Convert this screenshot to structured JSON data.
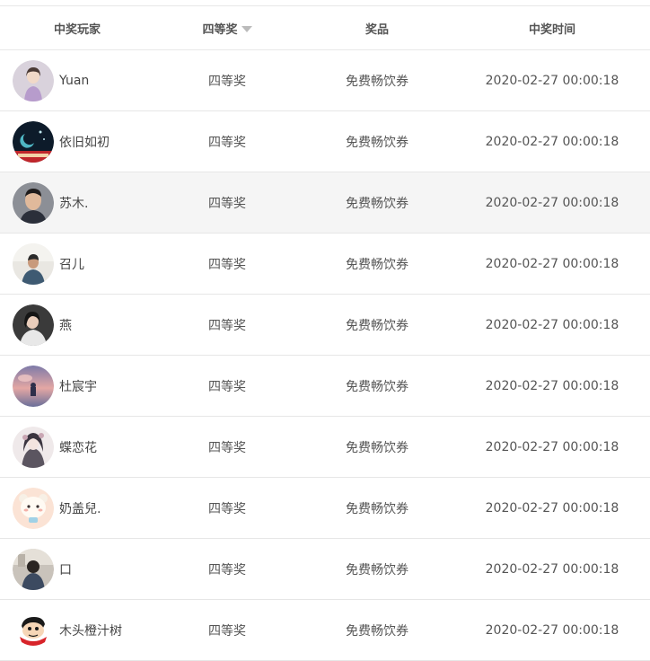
{
  "header": {
    "player": "中奖玩家",
    "tier": "四等奖",
    "prize": "奖品",
    "time": "中奖时间"
  },
  "rows": [
    {
      "name": "Yuan",
      "tier": "四等奖",
      "prize": "免费畅饮券",
      "time": "2020-02-27 00:00:18",
      "avatar": "avatar-girl-lavender"
    },
    {
      "name": "依旧如初",
      "tier": "四等奖",
      "prize": "免费畅饮券",
      "time": "2020-02-27 00:00:18",
      "avatar": "avatar-night-moon"
    },
    {
      "name": "苏木.",
      "tier": "四等奖",
      "prize": "免费畅饮券",
      "time": "2020-02-27 00:00:18",
      "avatar": "avatar-man-selfie"
    },
    {
      "name": "召儿",
      "tier": "四等奖",
      "prize": "免费畅饮券",
      "time": "2020-02-27 00:00:18",
      "avatar": "avatar-man-outdoor"
    },
    {
      "name": "燕",
      "tier": "四等奖",
      "prize": "免费畅饮券",
      "time": "2020-02-27 00:00:18",
      "avatar": "avatar-woman-dark"
    },
    {
      "name": "杜宸宇",
      "tier": "四等奖",
      "prize": "免费畅饮券",
      "time": "2020-02-27 00:00:18",
      "avatar": "avatar-sunset-sky"
    },
    {
      "name": "蝶恋花",
      "tier": "四等奖",
      "prize": "免费畅饮券",
      "time": "2020-02-27 00:00:18",
      "avatar": "avatar-anime-girl"
    },
    {
      "name": "奶盖兒.",
      "tier": "四等奖",
      "prize": "免费畅饮券",
      "time": "2020-02-27 00:00:18",
      "avatar": "avatar-cute-bear"
    },
    {
      "name": "口",
      "tier": "四等奖",
      "prize": "免费畅饮券",
      "time": "2020-02-27 00:00:18",
      "avatar": "avatar-man-back"
    },
    {
      "name": "木头橙汁树",
      "tier": "四等奖",
      "prize": "免费畅饮券",
      "time": "2020-02-27 00:00:18",
      "avatar": "avatar-cartoon-boy"
    }
  ],
  "highlighted_row": 2,
  "colors": {
    "header_text": "#555555",
    "cell_text": "#555555",
    "row_border": "#e6e6e6",
    "highlight_bg": "#f5f5f5",
    "sort_icon": "#bbbbbb"
  }
}
